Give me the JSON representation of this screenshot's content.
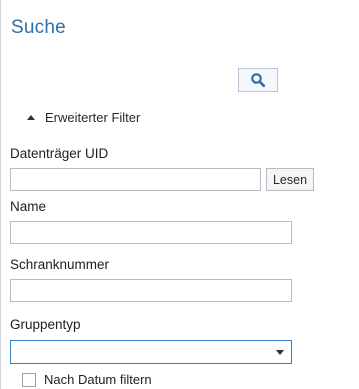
{
  "panel": {
    "title": "Suche"
  },
  "toolbar": {
    "search_icon": "search-icon"
  },
  "filter": {
    "toggle_label": "Erweiterter Filter",
    "expanded": true
  },
  "fields": {
    "datentraeger_uid": {
      "label": "Datenträger UID",
      "value": "",
      "read_button_label": "Lesen"
    },
    "name": {
      "label": "Name",
      "value": ""
    },
    "schranknummer": {
      "label": "Schranknummer",
      "value": ""
    },
    "gruppentyp": {
      "label": "Gruppentyp",
      "selected": ""
    }
  },
  "date_filter": {
    "label": "Nach Datum filtern",
    "checked": false
  },
  "colors": {
    "accent": "#2e6ea8",
    "focus_border": "#2e7fc8"
  }
}
